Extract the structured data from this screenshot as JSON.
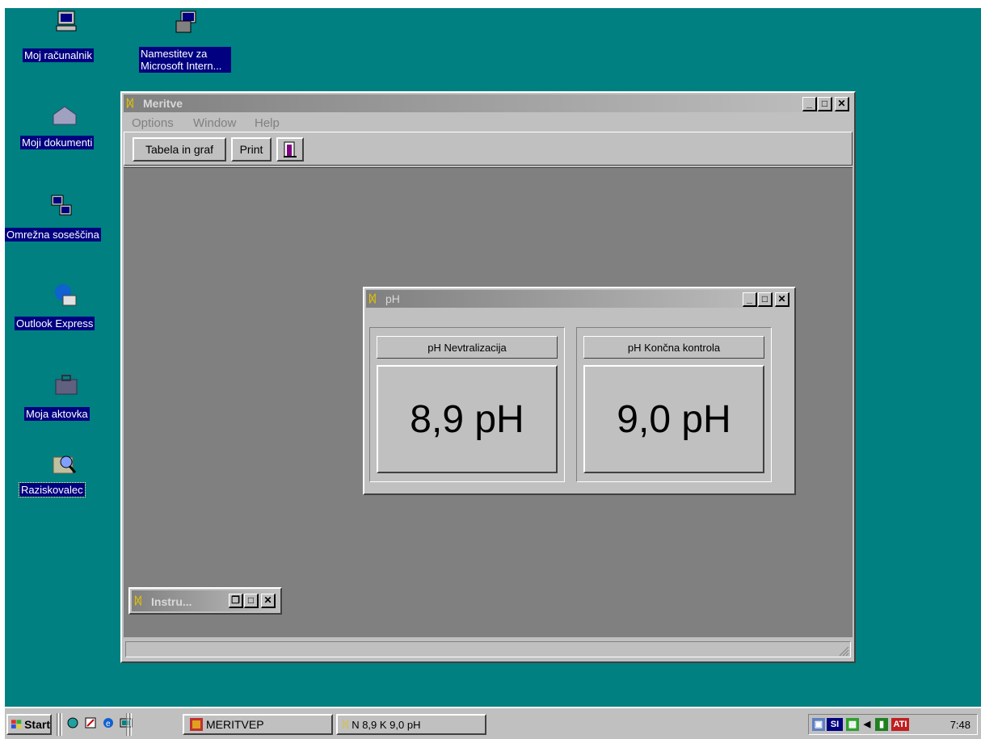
{
  "desktop_icons": [
    {
      "label": "Moj računalnik",
      "icon": "my-computer-icon"
    },
    {
      "label": "Namestitev za Microsoft Intern...",
      "icon": "setup-icon"
    },
    {
      "label": "Moji dokumenti",
      "icon": "my-documents-icon"
    },
    {
      "label": "Omrežna soseščina",
      "icon": "network-neighborhood-icon"
    },
    {
      "label": "Outlook Express",
      "icon": "outlook-express-icon"
    },
    {
      "label": "Moja aktovka",
      "icon": "briefcase-icon"
    },
    {
      "label": "Raziskovalec",
      "icon": "explorer-icon"
    }
  ],
  "main_window": {
    "title": "Meritve",
    "menu": [
      "Options",
      "Window",
      "Help"
    ],
    "toolbar": {
      "tabela_label": "Tabela in graf",
      "print_label": "Print",
      "exit_icon": "exit-door-icon"
    }
  },
  "ph_window": {
    "title": "pH",
    "panels": [
      {
        "caption": "pH Nevtralizacija",
        "value": "8,9 pH"
      },
      {
        "caption": "pH Končna kontrola",
        "value": "9,0 pH"
      }
    ]
  },
  "instru_window": {
    "title": "Instru..."
  },
  "taskbar": {
    "start_label": "Start",
    "quick_launch": [
      "network-icon",
      "edit-icon",
      "ie-icon",
      "desktop-icon"
    ],
    "tasks": [
      {
        "label": "MERITVEP",
        "icon": "meritvep-icon"
      },
      {
        "label": "N 8,9  K 9,0 pH",
        "icon": "meritve-icon"
      }
    ],
    "tray": {
      "lang": "SI",
      "clock": "7:48"
    }
  },
  "colors": {
    "desktop": "#008080",
    "selection": "#000080",
    "face": "#c0c0c0",
    "mdi": "#808080"
  }
}
